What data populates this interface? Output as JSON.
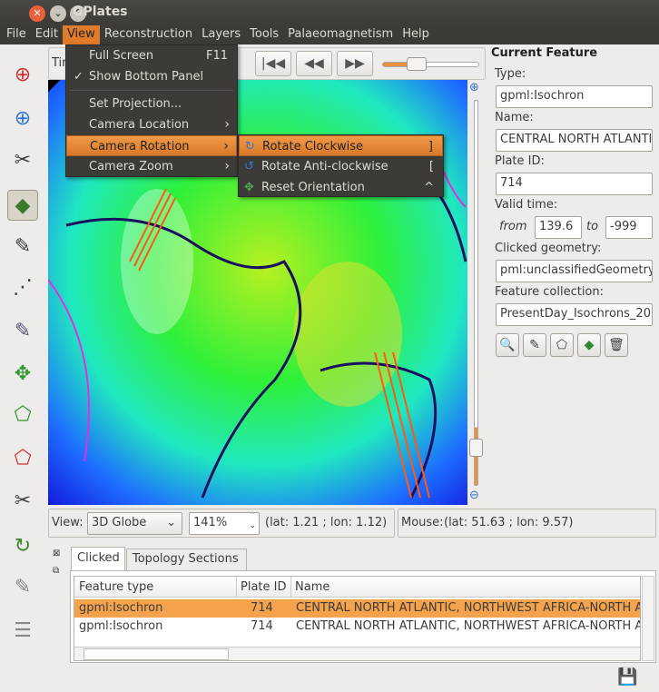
{
  "window": {
    "title": "GPlates"
  },
  "menubar": [
    "File",
    "Edit",
    "View",
    "Reconstruction",
    "Layers",
    "Tools",
    "Palaeomagnetism",
    "Help"
  ],
  "view_menu": {
    "items": [
      {
        "label": "Full Screen",
        "shortcut": "F11"
      },
      {
        "label": "Show Bottom Panel",
        "checked": true
      },
      {
        "label": "Set Projection..."
      },
      {
        "label": "Camera Location",
        "submenu": true
      },
      {
        "label": "Camera Rotation",
        "submenu": true,
        "highlighted": true
      },
      {
        "label": "Camera Zoom",
        "submenu": true
      }
    ]
  },
  "rotation_submenu": [
    {
      "label": "Rotate Clockwise",
      "shortcut": "]",
      "icon": "rotate-clockwise-icon",
      "highlighted": true
    },
    {
      "label": "Rotate Anti-clockwise",
      "shortcut": "[",
      "icon": "rotate-anticlockwise-icon"
    },
    {
      "label": "Reset Orientation",
      "shortcut": "^",
      "icon": "reset-orientation-icon"
    }
  ],
  "timebar": {
    "label_partial": "Tim",
    "buttons": [
      "|◀◀",
      "◀◀",
      "▶▶"
    ],
    "slider_value_fraction": 0.35
  },
  "current_feature": {
    "title": "Current Feature",
    "type_label": "Type:",
    "type": "gpml:Isochron",
    "name_label": "Name:",
    "name": "CENTRAL NORTH ATLANTI",
    "plate_label": "Plate ID:",
    "plate_id": "714",
    "valid_label": "Valid time:",
    "from_label": "from",
    "from": "139.6",
    "to_label": "to",
    "to": "-999",
    "geom_label": "Clicked geometry:",
    "geometry": "pml:unclassifiedGeometry",
    "coll_label": "Feature collection:",
    "collection": "PresentDay_Isochrons_20"
  },
  "viewbar": {
    "view_label": "View:",
    "projection": "3D Globe",
    "zoom": "141%",
    "camera": "(lat: 1.21 ; lon: 1.12)",
    "mouse_label": "Mouse:",
    "mouse": "(lat: 51.63 ; lon: 9.57)"
  },
  "bottom": {
    "tabs": [
      "Clicked",
      "Topology Sections"
    ],
    "columns": [
      "Feature type",
      "Plate ID",
      "Name"
    ],
    "rows": [
      {
        "type": "gpml:Isochron",
        "plate": "714",
        "name": "CENTRAL NORTH ATLANTIC, NORTHWEST AFRICA-NORTH A",
        "selected": true
      },
      {
        "type": "gpml:Isochron",
        "plate": "714",
        "name": "CENTRAL NORTH ATLANTIC, NORTHWEST AFRICA-NORTH A"
      }
    ]
  },
  "colors": {
    "accent": "#e07b2c",
    "selection": "#f4a24c",
    "menubg": "#3c3b37"
  }
}
